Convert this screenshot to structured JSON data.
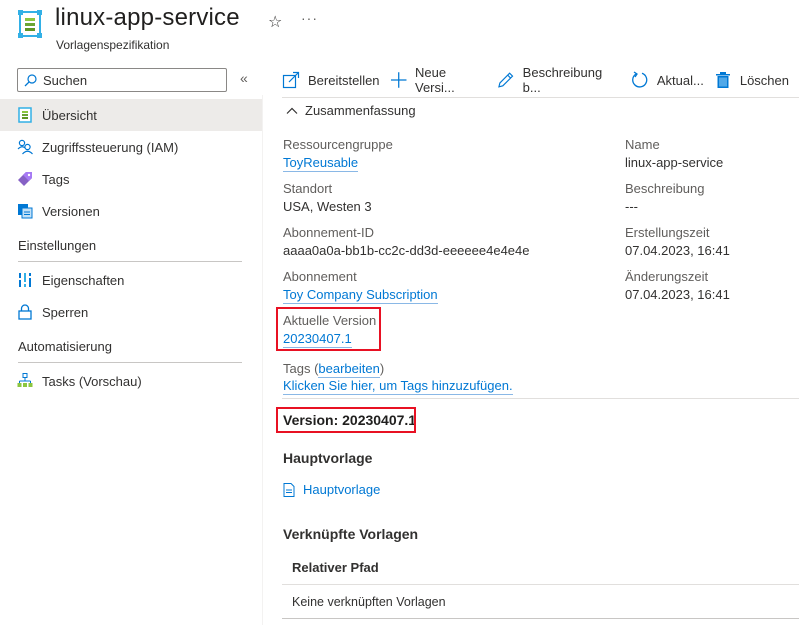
{
  "header": {
    "title": "linux-app-service",
    "subtitle": "Vorlagenspezifikation",
    "favorite_icon": "star-icon",
    "more_icon": "ellipsis-icon"
  },
  "sidebar": {
    "search": {
      "placeholder": "Suchen",
      "value": ""
    },
    "collapse_icon": "double-chevron-left-icon",
    "items": [
      {
        "label": "Übersicht",
        "icon": "template-spec-icon",
        "selected": true
      },
      {
        "label": "Zugriffssteuerung (IAM)",
        "icon": "people-icon"
      },
      {
        "label": "Tags",
        "icon": "tag-icon"
      },
      {
        "label": "Versionen",
        "icon": "versions-icon"
      }
    ],
    "sections": [
      {
        "title": "Einstellungen",
        "items": [
          {
            "label": "Eigenschaften",
            "icon": "properties-icon"
          },
          {
            "label": "Sperren",
            "icon": "lock-icon"
          }
        ]
      },
      {
        "title": "Automatisierung",
        "items": [
          {
            "label": "Tasks (Vorschau)",
            "icon": "tasks-icon"
          }
        ]
      }
    ]
  },
  "toolbar": {
    "buttons": [
      {
        "label": "Bereitstellen",
        "icon": "deploy-icon"
      },
      {
        "label": "Neue Versi...",
        "icon": "plus-icon"
      },
      {
        "label": "Beschreibung b...",
        "icon": "edit-icon"
      },
      {
        "label": "Aktual...",
        "icon": "refresh-icon"
      },
      {
        "label": "Löschen",
        "icon": "delete-icon"
      }
    ]
  },
  "essentials": {
    "toggle_label": "Zusammenfassung",
    "left": [
      {
        "label": "Ressourcengruppe",
        "value": "ToyReusable",
        "link": true
      },
      {
        "label": "Standort",
        "value": "USA, Westen 3",
        "link": false
      },
      {
        "label": "Abonnement-ID",
        "value": "aaaa0a0a-bb1b-cc2c-dd3d-eeeeee4e4e4e",
        "link": false
      },
      {
        "label": "Abonnement",
        "value": "Toy Company Subscription",
        "link": true
      },
      {
        "label": "Aktuelle Version",
        "value": "20230407.1",
        "link": true,
        "highlighted": true
      }
    ],
    "right": [
      {
        "label": "Name",
        "value": "linux-app-service"
      },
      {
        "label": "Beschreibung",
        "value": "---"
      },
      {
        "label": "Erstellungszeit",
        "value": "07.04.2023, 16:41"
      },
      {
        "label": "Änderungszeit",
        "value": "07.04.2023, 16:41"
      }
    ],
    "tags": {
      "label": "Tags (",
      "edit_link": "bearbeiten",
      "label_end": ")",
      "add_link": "Klicken Sie hier, um Tags hinzuzufügen."
    }
  },
  "version": {
    "heading": "Version: 20230407.1",
    "highlighted": true
  },
  "main_template": {
    "title": "Hauptvorlage",
    "link": "Hauptvorlage"
  },
  "linked_templates": {
    "title": "Verknüpfte Vorlagen",
    "columns": [
      "Relativer Pfad"
    ],
    "empty_text": "Keine verknüpften Vorlagen"
  },
  "colors": {
    "accent": "#0078d4",
    "highlight_border": "#e81123",
    "selected_bg": "#edebe9"
  }
}
